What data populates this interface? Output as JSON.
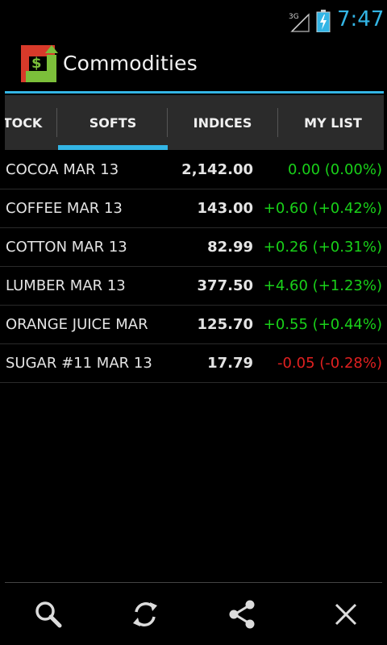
{
  "status_bar": {
    "network_label": "3G",
    "time": "7:47",
    "signal_icon": "signal-icon",
    "battery_icon": "battery-charging-icon",
    "accent_color": "#33b5e5"
  },
  "action_bar": {
    "title": "Commodities",
    "icon": "commodities-app-icon"
  },
  "tabs": [
    {
      "label": "TOCK"
    },
    {
      "label": "SOFTS",
      "selected": true
    },
    {
      "label": "INDICES"
    },
    {
      "label": "MY LIST"
    }
  ],
  "quotes": [
    {
      "name": "COCOA MAR 13",
      "price": "2,142.00",
      "change": "0.00 (0.00%)",
      "direction": "up"
    },
    {
      "name": "COFFEE MAR 13",
      "price": "143.00",
      "change": "+0.60 (+0.42%)",
      "direction": "up"
    },
    {
      "name": "COTTON MAR 13",
      "price": "82.99",
      "change": "+0.26 (+0.31%)",
      "direction": "up"
    },
    {
      "name": "LUMBER MAR 13",
      "price": "377.50",
      "change": "+4.60 (+1.23%)",
      "direction": "up"
    },
    {
      "name": "ORANGE JUICE MAR",
      "price": "125.70",
      "change": "+0.55 (+0.44%)",
      "direction": "up"
    },
    {
      "name": "SUGAR #11 MAR 13",
      "price": "17.79",
      "change": "-0.05 (-0.28%)",
      "direction": "down"
    }
  ],
  "colors": {
    "positive": "#19d119",
    "negative": "#e02020",
    "accent": "#33b5e5"
  },
  "bottom_bar": {
    "buttons": [
      {
        "icon": "search-icon"
      },
      {
        "icon": "refresh-icon"
      },
      {
        "icon": "share-icon"
      },
      {
        "icon": "close-icon"
      }
    ]
  }
}
